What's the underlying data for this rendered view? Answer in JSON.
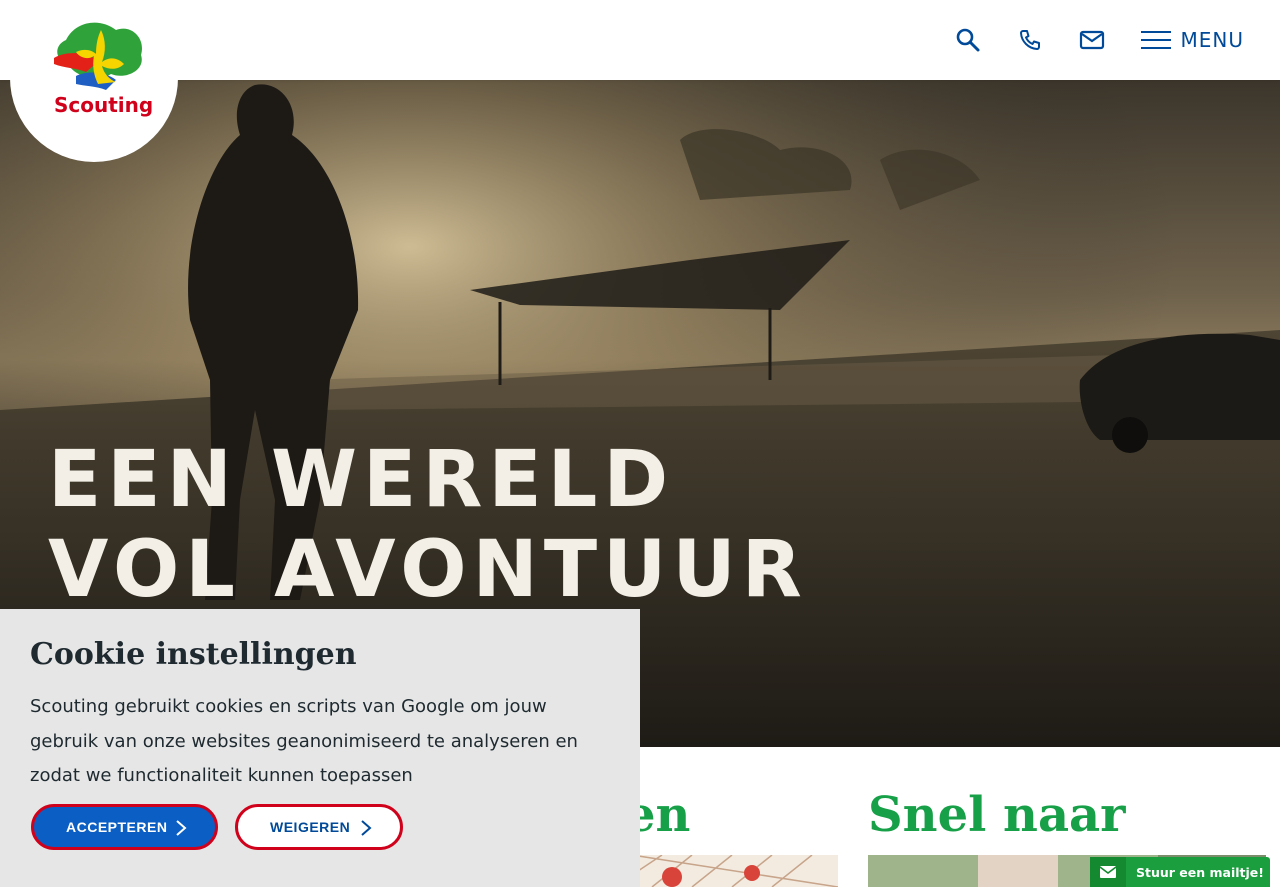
{
  "brand": {
    "name": "Scouting",
    "accent": "#18a049",
    "blue": "#004a99"
  },
  "header": {
    "search_icon": "search-icon",
    "phone_icon": "phone-icon",
    "mail_icon": "mail-icon",
    "menu_label": "MENU"
  },
  "hero": {
    "title": "Een wereld vol avontuur"
  },
  "sections": {
    "left_title_fragment": "en",
    "right_title": "Snel naar"
  },
  "cookie": {
    "title": "Cookie instellingen",
    "text": "Scouting gebruikt cookies en scripts van Google om jouw gebruik van onze websites geanonimiseerd te analyseren en zodat we functionaliteit kunnen toepassen",
    "accept_label": "ACCEPTEREN",
    "decline_label": "WEIGEREN"
  },
  "mail_widget": {
    "label": "Stuur een mailtje!"
  }
}
